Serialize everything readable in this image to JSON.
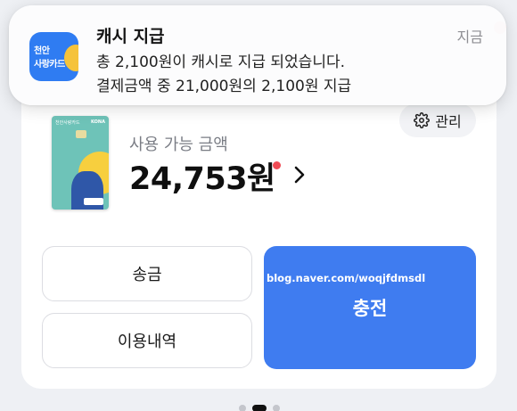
{
  "notification": {
    "app_icon_line1": "천안",
    "app_icon_line2": "사랑카드",
    "title": "캐시 지급",
    "time": "지금",
    "body_line1": "총 2,100원이 캐시로 지급 되었습니다.",
    "body_line2": "결제금액 중 21,000원의 2,100원 지급"
  },
  "card": {
    "manage_label": "관리",
    "card_brand_left": "천안사랑카드",
    "card_brand_right": "KONA",
    "balance_label": "사용 가능 금액",
    "balance_amount": "24,753원"
  },
  "actions": {
    "send_label": "송금",
    "history_label": "이용내역",
    "charge_label": "충전"
  },
  "watermark": "blog.naver.com/woqjfdmsdl",
  "pager": {
    "pages": 3,
    "active_index": 1
  },
  "colors": {
    "accent": "#3f7cf0",
    "app_icon_bg": "#2f7cf2",
    "notification_dot": "#f04b55",
    "card_teal": "#6ec3b8",
    "card_yellow": "#f7cf3e"
  }
}
